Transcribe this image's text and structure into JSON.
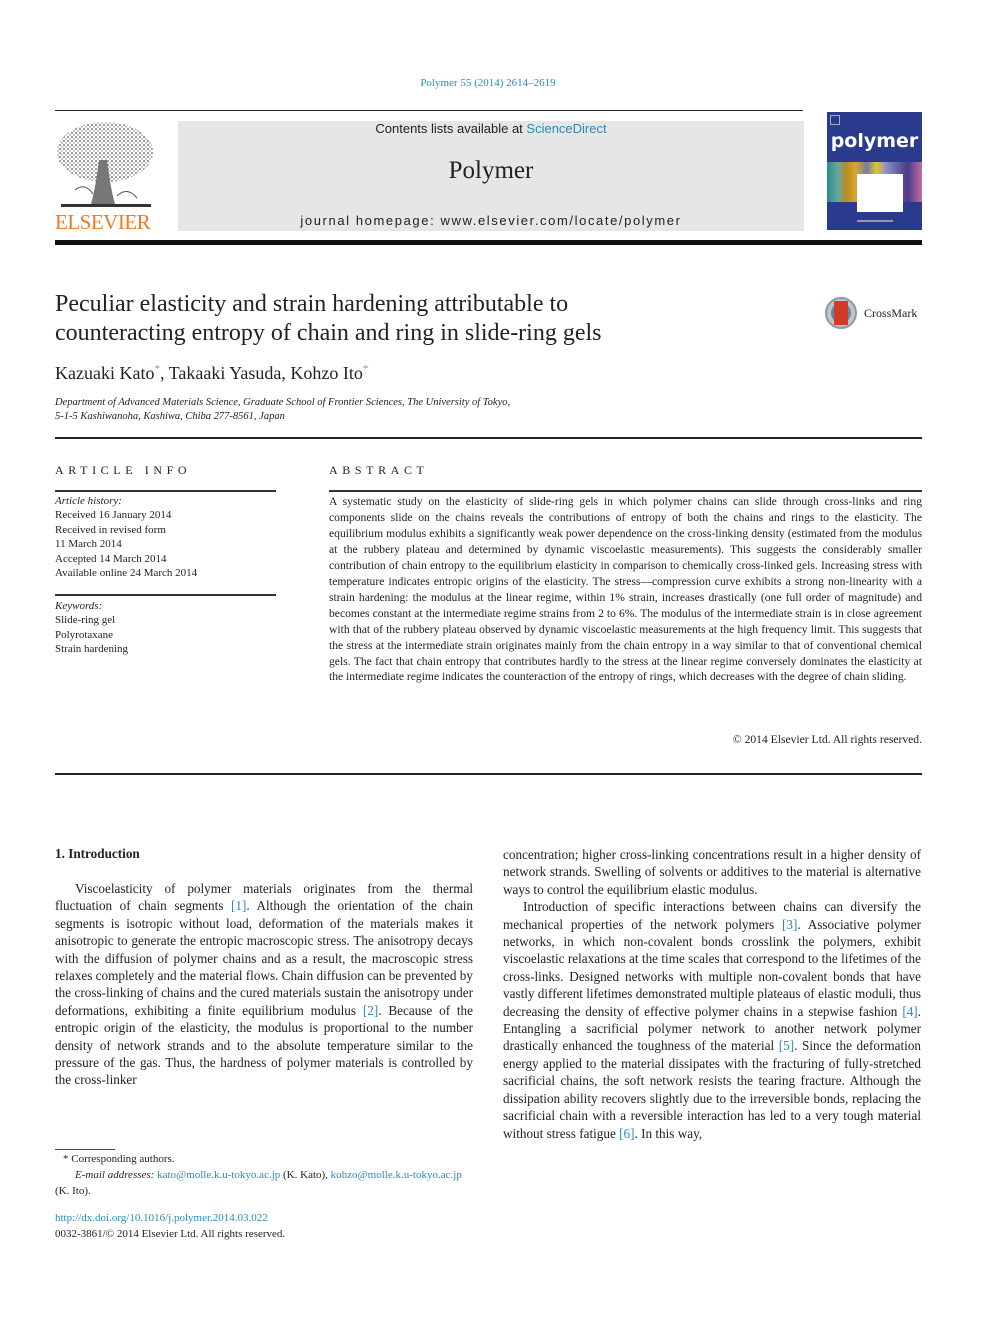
{
  "header": {
    "citation": "Polymer 55 (2014) 2614–2619",
    "publisher_logo_text": "ELSEVIER",
    "contents_prefix": "Contents lists available at ",
    "contents_link": "ScienceDirect",
    "journal_name": "Polymer",
    "homepage": "journal homepage: www.elsevier.com/locate/polymer",
    "cover_title": "polymer",
    "crossmark_label": "CrossMark"
  },
  "article": {
    "title_line1": "Peculiar elasticity and strain hardening attributable to",
    "title_line2": "counteracting entropy of chain and ring in slide-ring gels",
    "authors": [
      {
        "name": "Kazuaki Kato",
        "mark": "*",
        "sep": ", "
      },
      {
        "name": "Takaaki Yasuda",
        "mark": "",
        "sep": ", "
      },
      {
        "name": "Kohzo Ito",
        "mark": "*",
        "sep": ""
      }
    ],
    "affiliation_line1": "Department of Advanced Materials Science, Graduate School of Frontier Sciences, The University of Tokyo,",
    "affiliation_line2": "5-1-5 Kashiwanoha, Kashiwa, Chiba 277-8561, Japan"
  },
  "article_info": {
    "heading": "ARTICLE INFO",
    "history_label": "Article history:",
    "history": [
      "Received 16 January 2014",
      "Received in revised form",
      "11 March 2014",
      "Accepted 14 March 2014",
      "Available online 24 March 2014"
    ],
    "keywords_label": "Keywords:",
    "keywords": [
      "Slide-ring gel",
      "Polyrotaxane",
      "Strain hardening"
    ]
  },
  "abstract": {
    "heading": "ABSTRACT",
    "text": "A systematic study on the elasticity of slide-ring gels in which polymer chains can slide through cross-links and ring components slide on the chains reveals the contributions of entropy of both the chains and rings to the elasticity. The equilibrium modulus exhibits a significantly weak power dependence on the cross-linking density (estimated from the modulus at the rubbery plateau and determined by dynamic viscoelastic measurements). This suggests the considerably smaller contribution of chain entropy to the equilibrium elasticity in comparison to chemically cross-linked gels. Increasing stress with temperature indicates entropic origins of the elasticity. The stress—compression curve exhibits a strong non-linearity with a strain hardening: the modulus at the linear regime, within 1% strain, increases drastically (one full order of magnitude) and becomes constant at the intermediate regime strains from 2 to 6%. The modulus of the intermediate strain is in close agreement with that of the rubbery plateau observed by dynamic viscoelastic measurements at the high frequency limit. This suggests that the stress at the intermediate strain originates mainly from the chain entropy in a way similar to that of conventional chemical gels. The fact that chain entropy that contributes hardly to the stress at the linear regime conversely dominates the elasticity at the intermediate regime indicates the counteraction of the entropy of rings, which decreases with the degree of chain sliding.",
    "copyright": "© 2014 Elsevier Ltd. All rights reserved."
  },
  "body": {
    "section_heading": "1.  Introduction",
    "left_p1_a": "Viscoelasticity of polymer materials originates from the thermal fluctuation of chain segments ",
    "ref1": "[1]",
    "left_p1_b": ". Although the orientation of the chain segments is isotropic without load, deformation of the materials makes it anisotropic to generate the entropic macroscopic stress. The anisotropy decays with the diffusion of polymer chains and as a result, the macroscopic stress relaxes completely and the material flows. Chain diffusion can be prevented by the cross-linking of chains and the cured materials sustain the anisotropy under deformations, exhibiting a finite equilibrium modulus ",
    "ref2": "[2]",
    "left_p1_c": ". Because of the entropic origin of the elasticity, the modulus is proportional to the number density of network strands and to the absolute temperature similar to the pressure of the gas. Thus, the hardness of polymer materials is controlled by the cross-linker",
    "right_p1": "concentration; higher cross-linking concentrations result in a higher density of network strands. Swelling of solvents or additives to the material is alternative ways to control the equilibrium elastic modulus.",
    "right_p2_a": "Introduction of specific interactions between chains can diversify the mechanical properties of the network polymers ",
    "ref3": "[3]",
    "right_p2_b": ". Associative polymer networks, in which non-covalent bonds crosslink the polymers, exhibit viscoelastic relaxations at the time scales that correspond to the lifetimes of the cross-links. Designed networks with multiple non-covalent bonds that have vastly different lifetimes demonstrated multiple plateaus of elastic moduli, thus decreasing the density of effective polymer chains in a stepwise fashion ",
    "ref4": "[4]",
    "right_p2_c": ". Entangling a sacrificial polymer network to another network polymer drastically enhanced the toughness of the material ",
    "ref5": "[5]",
    "right_p2_d": ". Since the deformation energy applied to the material dissipates with the fracturing of fully-stretched sacrificial chains, the soft network resists the tearing fracture. Although the dissipation ability recovers slightly due to the irreversible bonds, replacing the sacrificial chain with a reversible interaction has led to a very tough material without stress fatigue ",
    "ref6": "[6]",
    "right_p2_e": ". In this way,"
  },
  "footnotes": {
    "corresponding": "*  Corresponding authors.",
    "email_label": "E-mail addresses: ",
    "email1": "kato@molle.k.u-tokyo.ac.jp",
    "email1_who": " (K. Kato), ",
    "email2": "kohzo@molle.k.u-tokyo.ac.jp",
    "email2_who": " (K. Ito).",
    "doi": "http://dx.doi.org/10.1016/j.polymer.2014.03.022",
    "issn": "0032-3861/© 2014 Elsevier Ltd. All rights reserved."
  },
  "colors": {
    "link": "#2a8ab8",
    "elsevier_orange": "#f07a20",
    "cover_blue": "#2a3a8c",
    "header_box": "#e6e6e6"
  }
}
